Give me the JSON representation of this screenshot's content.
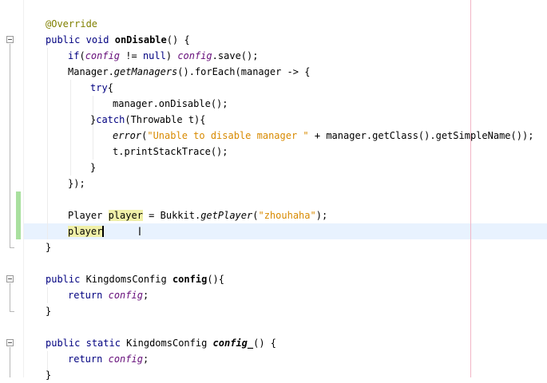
{
  "editor": {
    "lines": {
      "l1": {
        "annotation": "@Override"
      },
      "l2": {
        "kw1": "public",
        "kw2": "void",
        "method": "onDisable",
        "rest": "() {"
      },
      "l3": {
        "kw": "if",
        "open": "(",
        "field1": "config",
        "mid": " != ",
        "nullkw": "null",
        "close": ") ",
        "field2": "config",
        "rest": ".save();"
      },
      "l4": {
        "start": "Manager.",
        "call": "getManagers",
        "rest": "().forEach(manager -> {"
      },
      "l5": {
        "kw": "try",
        "rest": "{"
      },
      "l6": {
        "text": "manager.onDisable();"
      },
      "l7": {
        "start": "}",
        "kw": "catch",
        "rest": "(Throwable t){"
      },
      "l8": {
        "call": "error",
        "open": "(",
        "str": "\"Unable to disable manager \"",
        "rest": " + manager.getClass().getSimpleName());"
      },
      "l9": {
        "text": "t.printStackTrace();"
      },
      "l10": {
        "text": "}"
      },
      "l11": {
        "text": "});"
      },
      "l13": {
        "type": "Player",
        "var": "player",
        "mid": " = Bukkit.",
        "call": "getPlayer",
        "open": "(",
        "str": "\"zhouhaha\"",
        "rest": ");"
      },
      "l14": {
        "var": "player"
      },
      "l15": {
        "text": "}"
      },
      "l17": {
        "kw": "public",
        "type": " KingdomsConfig ",
        "method": "config",
        "rest": "(){"
      },
      "l18": {
        "kw": "return",
        "field": "config",
        "rest": ";"
      },
      "l19": {
        "text": "}"
      },
      "l21": {
        "kw1": "public",
        "kw2": "static",
        "type": " KingdomsConfig ",
        "method": "config_",
        "rest": "() {"
      },
      "l22": {
        "kw": "return",
        "field": "config",
        "rest": ";"
      },
      "l23": {
        "text": "}"
      }
    },
    "icons": {
      "fold": "fold-collapse-icon",
      "cursor": "text-cursor-icon"
    }
  },
  "colors": {
    "keyword": "#000080",
    "annotation": "#808000",
    "field": "#660e7a",
    "string": "#d88a00",
    "current_line": "#e8f2fe",
    "change_bar": "#a9e09f",
    "occurrence_highlight": "#f0f0a8",
    "right_margin": "#f2b6c6"
  }
}
